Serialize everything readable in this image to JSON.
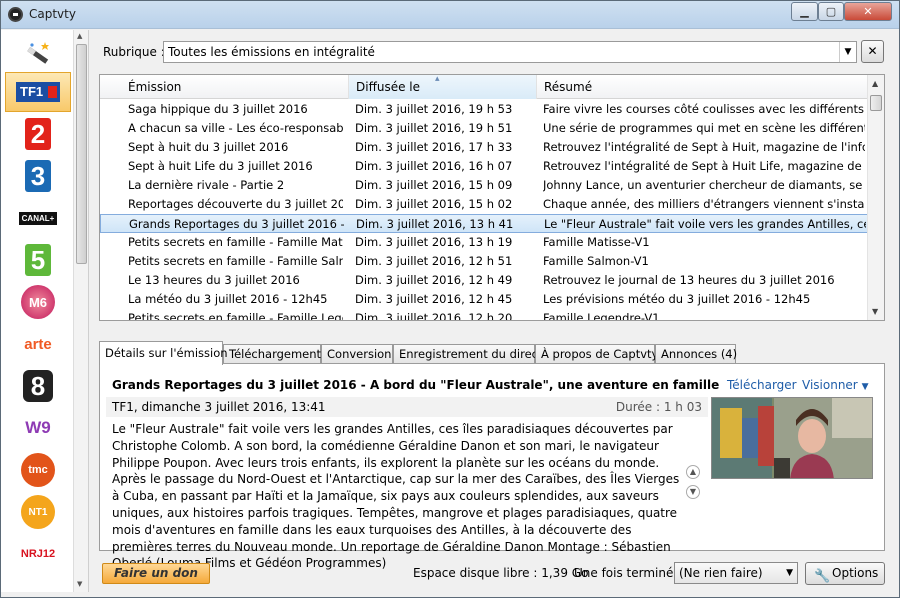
{
  "window": {
    "title": "Captvty"
  },
  "titlebar_buttons": {
    "minimize": "▁",
    "maximize": "▢",
    "close": "✕"
  },
  "sidebar": {
    "channels": [
      {
        "id": "tools",
        "label": ""
      },
      {
        "id": "tf1",
        "label": "TF1"
      },
      {
        "id": "france2",
        "label": "2"
      },
      {
        "id": "france3",
        "label": "3"
      },
      {
        "id": "canalplus",
        "label": "CANAL+"
      },
      {
        "id": "france5",
        "label": "5"
      },
      {
        "id": "m6",
        "label": "M6"
      },
      {
        "id": "arte",
        "label": "arte"
      },
      {
        "id": "d8",
        "label": "8"
      },
      {
        "id": "w9",
        "label": "W9"
      },
      {
        "id": "tmc",
        "label": "tmc"
      },
      {
        "id": "nt1",
        "label": "NT1"
      },
      {
        "id": "nrj12",
        "label": "NRJ12"
      }
    ],
    "selected": "tf1"
  },
  "rubrique": {
    "label": "Rubrique :",
    "value": "Toutes les émissions en intégralité"
  },
  "list": {
    "columns": [
      "Émission",
      "Diffusée le",
      "Résumé"
    ],
    "rows": [
      [
        "Saga hippique du 3 juillet 2016",
        "Dim. 3 juillet 2016, 19 h 53",
        "Faire vivre les courses côté coulisses avec les différents act..."
      ],
      [
        "A chacun sa ville - Les éco-responsables",
        "Dim. 3 juillet 2016, 19 h 51",
        "Une série de programmes qui met en scène les différentes..."
      ],
      [
        "Sept à huit du 3 juillet 2016",
        "Dim. 3 juillet 2016, 17 h 33",
        "Retrouvez l'intégralité de Sept à Huit, magazine de l'infor..."
      ],
      [
        "Sept à huit Life du 3 juillet 2016",
        "Dim. 3 juillet 2016, 16 h 07",
        "Retrouvez l'intégralité de Sept à Huit Life, magazine de l'in..."
      ],
      [
        "La dernière rivale - Partie 2",
        "Dim. 3 juillet 2016, 15 h 09",
        "Johnny Lance, un aventurier chercheur de diamants, se ret..."
      ],
      [
        "Reportages découverte du 3 juillet 201...",
        "Dim. 3 juillet 2016, 15 h 02",
        "Chaque année, des milliers d'étrangers viennent s'installe..."
      ],
      [
        "Grands Reportages du 3 juillet 2016 - A...",
        "Dim. 3 juillet 2016, 13 h 41",
        "Le \"Fleur Australe\" fait voile vers les grandes Antilles, ces îl..."
      ],
      [
        "Petits secrets en famille - Famille Matis...",
        "Dim. 3 juillet 2016, 13 h 19",
        "Famille Matisse-V1"
      ],
      [
        "Petits secrets en famille - Famille Salm...",
        "Dim. 3 juillet 2016, 12 h 51",
        "Famille Salmon-V1"
      ],
      [
        "Le 13 heures du 3 juillet 2016",
        "Dim. 3 juillet 2016, 12 h 49",
        "Retrouvez le journal de 13 heures du 3 juillet 2016"
      ],
      [
        "La météo du 3 juillet 2016 - 12h45",
        "Dim. 3 juillet 2016, 12 h 45",
        "Les prévisions météo du 3 juillet 2016 - 12h45"
      ],
      [
        "Petits secrets en famille - Famille Lege...",
        "Dim. 3 juillet 2016, 12 h 20",
        "Famille Legendre-V1"
      ]
    ],
    "selected_index": 6
  },
  "tabs": [
    "Détails sur l'émission",
    "Téléchargement",
    "Conversion",
    "Enregistrement du direct",
    "À propos de Captvty",
    "Annonces (4)"
  ],
  "details": {
    "title": "Grands Reportages du 3 juillet 2016 - A bord du \"Fleur Australe\", une aventure en famille",
    "download_link": "Télécharger",
    "view_link": "Visionner",
    "meta": "TF1, dimanche 3 juillet 2016, 13:41",
    "duration": "Durée : 1 h 03",
    "description": "Le \"Fleur Australe\" fait voile vers les grandes Antilles, ces îles paradisiaques découvertes par Christophe Colomb. A son bord, la comédienne Géraldine Danon et son mari, le navigateur Philippe Poupon. Avec leurs trois enfants, ils explorent la planète sur les océans du monde. Après le passage du Nord-Ouest et l'Antarctique, cap sur la mer des Caraïbes, des Îles Vierges à Cuba, en passant par Haïti et la Jamaïque, six pays aux couleurs splendides, aux saveurs uniques, aux histoires parfois tragiques. Tempêtes, mangrove et plages paradisiaques, quatre mois d'aventures en famille dans les eaux turquoises des Antilles, à la découverte des premières terres du Nouveau monde. Un reportage de Géraldine Danon Montage : Sébastien Oberlé (Louma Films et Gédéon Programmes)"
  },
  "footer": {
    "donate": "Faire un don",
    "disk": "Espace disque libre : 1,39 Go",
    "when_done_label": "Une fois terminé :",
    "when_done_value": "(Ne rien faire)",
    "options": "Options"
  },
  "colors": {
    "selection": "#cfe5f8",
    "link": "#1f5da8",
    "tf1_blue": "#1b4ea3",
    "tf1_red": "#e2231a"
  }
}
